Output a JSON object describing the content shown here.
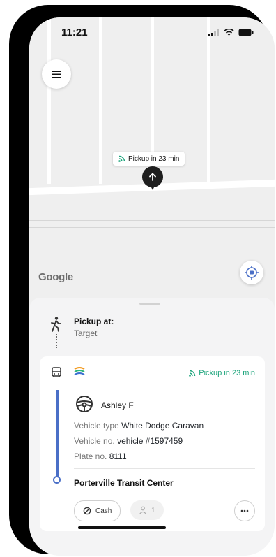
{
  "status_bar": {
    "time": "11:21"
  },
  "map": {
    "pickup_chip": "Pickup in 23 min",
    "attribution": "Google"
  },
  "sheet": {
    "pickup_label": "Pickup at:",
    "pickup_place": "Target"
  },
  "card": {
    "pickup_eta": "Pickup in 23 min",
    "driver_name": "Ashley F",
    "vehicle_type_label": "Vehicle type",
    "vehicle_type_value": "White Dodge Caravan",
    "vehicle_no_label": "Vehicle no.",
    "vehicle_no_value": "vehicle #1597459",
    "plate_label": "Plate no.",
    "plate_value": "8111",
    "destination": "Porterville Transit Center",
    "payment_label": "Cash",
    "passengers": "1",
    "accent_color": "#1aa37a",
    "route_color": "#4a6fc7"
  }
}
